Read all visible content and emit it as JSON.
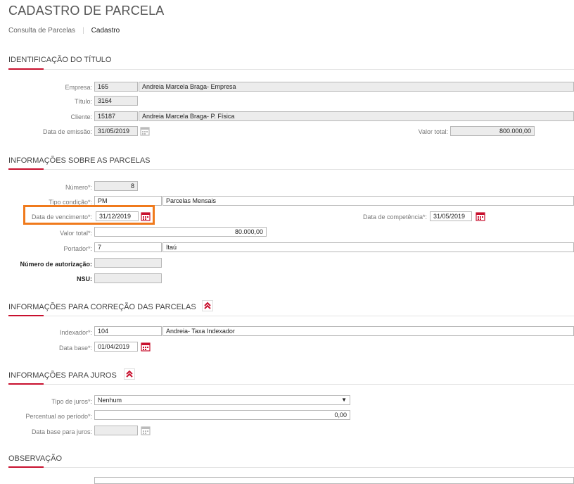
{
  "page": {
    "title": "CADASTRO DE PARCELA",
    "breadcrumb": {
      "link": "Consulta de Parcelas",
      "current": "Cadastro"
    }
  },
  "sections": {
    "titulo": "IDENTIFICAÇÃO DO TÍTULO",
    "parcelas": "INFORMAÇÕES SOBRE AS PARCELAS",
    "correcao": "INFORMAÇÕES PARA CORREÇÃO DAS PARCELAS",
    "juros": "INFORMAÇÕES PARA JUROS",
    "observacao": "OBSERVAÇÃO"
  },
  "titulo": {
    "empresa": {
      "label": "Empresa:",
      "code": "165",
      "name": "Andreia Marcela Braga- Empresa"
    },
    "titulo": {
      "label": "Título:",
      "value": "3164"
    },
    "cliente": {
      "label": "Cliente:",
      "code": "15187",
      "name": "Andreia Marcela Braga- P. Física"
    },
    "data_emissao": {
      "label": "Data de emissão:",
      "value": "31/05/2019"
    },
    "valor_total": {
      "label": "Valor total:",
      "value": "800.000,00"
    }
  },
  "parcelas": {
    "numero": {
      "label": "Número*:",
      "value": "8"
    },
    "tipo_condicao": {
      "label": "Tipo condição*:",
      "code": "PM",
      "name": "Parcelas Mensais"
    },
    "data_vencimento": {
      "label": "Data de vencimento*:",
      "value": "31/12/2019"
    },
    "data_competencia": {
      "label": "Data de competência*:",
      "value": "31/05/2019"
    },
    "valor_total": {
      "label": "Valor total*:",
      "value": "80.000,00"
    },
    "portador": {
      "label": "Portador*:",
      "code": "7",
      "name": "Itaú"
    },
    "num_autorizacao": {
      "label": "Número de autorização:",
      "value": ""
    },
    "nsu": {
      "label": "NSU:",
      "value": ""
    }
  },
  "correcao": {
    "indexador": {
      "label": "Indexador*:",
      "code": "104",
      "name": "Andreia- Taxa Indexador"
    },
    "data_base": {
      "label": "Data base*:",
      "value": "01/04/2019"
    }
  },
  "juros": {
    "tipo": {
      "label": "Tipo de juros*:",
      "value": "Nenhum"
    },
    "percentual": {
      "label": "Percentual ao período*:",
      "value": "0,00"
    },
    "data_base": {
      "label": "Data base para juros:",
      "value": ""
    }
  },
  "colors": {
    "accent": "#c8102e",
    "highlight": "#f07a1c"
  },
  "icons": {
    "calendar": "calendar-icon",
    "collapse": "double-chevron-up-icon",
    "dropdown": "dropdown-arrow-icon"
  }
}
